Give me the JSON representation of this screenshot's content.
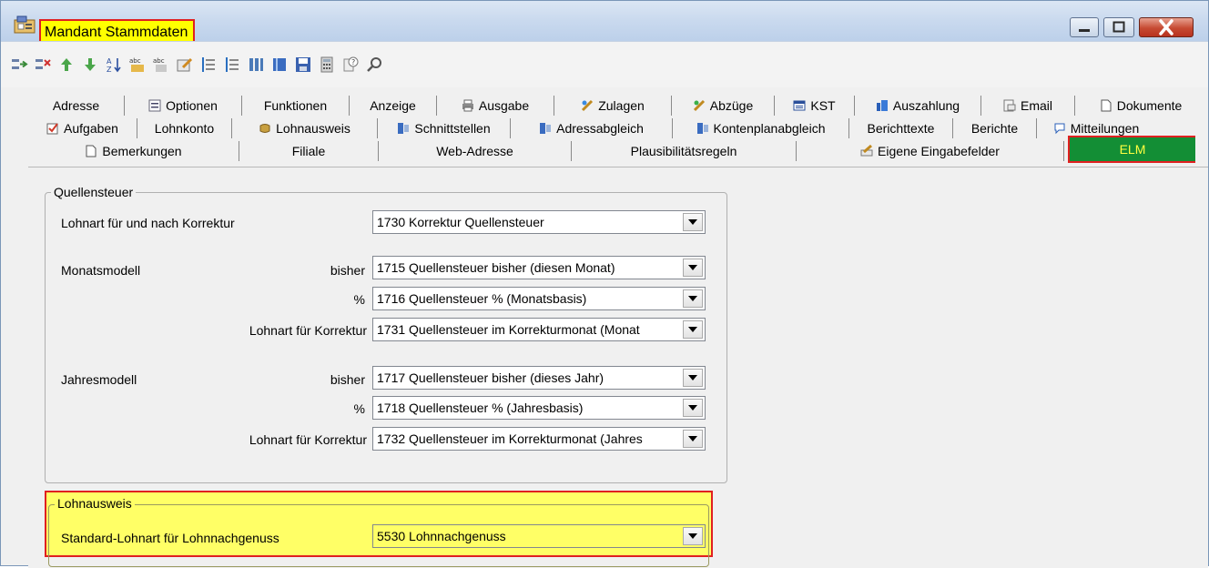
{
  "window": {
    "title": "Mandant Stammdaten"
  },
  "tabs": {
    "row1": [
      {
        "label": "Adresse",
        "icon": ""
      },
      {
        "label": "Optionen",
        "icon": "options-icon"
      },
      {
        "label": "Funktionen",
        "icon": ""
      },
      {
        "label": "Anzeige",
        "icon": ""
      },
      {
        "label": "Ausgabe",
        "icon": "printer-icon"
      },
      {
        "label": "Zulagen",
        "icon": "zulagen-icon"
      },
      {
        "label": "Abzüge",
        "icon": "abzuege-icon"
      },
      {
        "label": "KST",
        "icon": "kst-icon"
      },
      {
        "label": "Auszahlung",
        "icon": "auszahlung-icon"
      },
      {
        "label": "Email",
        "icon": "email-icon"
      },
      {
        "label": "Dokumente",
        "icon": "document-icon"
      }
    ],
    "row2": [
      {
        "label": "Aufgaben",
        "icon": "tasks-icon"
      },
      {
        "label": "Lohnkonto",
        "icon": ""
      },
      {
        "label": "Lohnausweis",
        "icon": "lohnausweis-icon"
      },
      {
        "label": "Schnittstellen",
        "icon": "interface-icon"
      },
      {
        "label": "Adressabgleich",
        "icon": "interface-icon"
      },
      {
        "label": "Kontenplanabgleich",
        "icon": "interface-icon"
      },
      {
        "label": "Berichttexte",
        "icon": ""
      },
      {
        "label": "Berichte",
        "icon": ""
      },
      {
        "label": "Mitteilungen",
        "icon": "speech-bubble-icon"
      }
    ],
    "row3": [
      {
        "label": "Bemerkungen",
        "icon": "document-icon"
      },
      {
        "label": "Filiale",
        "icon": ""
      },
      {
        "label": "Web-Adresse",
        "icon": ""
      },
      {
        "label": "Plausibilitätsregeln",
        "icon": ""
      },
      {
        "label": "Eigene Eingabefelder",
        "icon": "custom-fields-icon"
      },
      {
        "label": "ELM",
        "icon": "",
        "active": true
      }
    ]
  },
  "quellensteuer": {
    "legend": "Quellensteuer",
    "korrektur_label": "Lohnart für und nach Korrektur",
    "korrektur_value": "1730 Korrektur Quellensteuer",
    "monatsmodell_label": "Monatsmodell",
    "monat_bisher_label": "bisher",
    "monat_bisher_value": "1715 Quellensteuer bisher (diesen Monat)",
    "monat_pct_label": "%",
    "monat_pct_value": "1716 Quellensteuer % (Monatsbasis)",
    "monat_korr_label": "Lohnart für Korrektur",
    "monat_korr_value": "1731 Quellensteuer im Korrekturmonat (Monat",
    "jahresmodell_label": "Jahresmodell",
    "jahr_bisher_label": "bisher",
    "jahr_bisher_value": "1717 Quellensteuer bisher (dieses Jahr)",
    "jahr_pct_label": "%",
    "jahr_pct_value": "1718 Quellensteuer % (Jahresbasis)",
    "jahr_korr_label": "Lohnart für Korrektur",
    "jahr_korr_value": "1732 Quellensteuer im Korrekturmonat (Jahres"
  },
  "lohnausweis": {
    "legend": "Lohnausweis",
    "standard_label": "Standard-Lohnart für Lohnnachgenuss",
    "standard_value": "5530 Lohnnachgenuss"
  },
  "colors": {
    "highlight_yellow": "#ffff66",
    "highlight_red": "#e02020",
    "elm_tab_green": "#138e35"
  }
}
